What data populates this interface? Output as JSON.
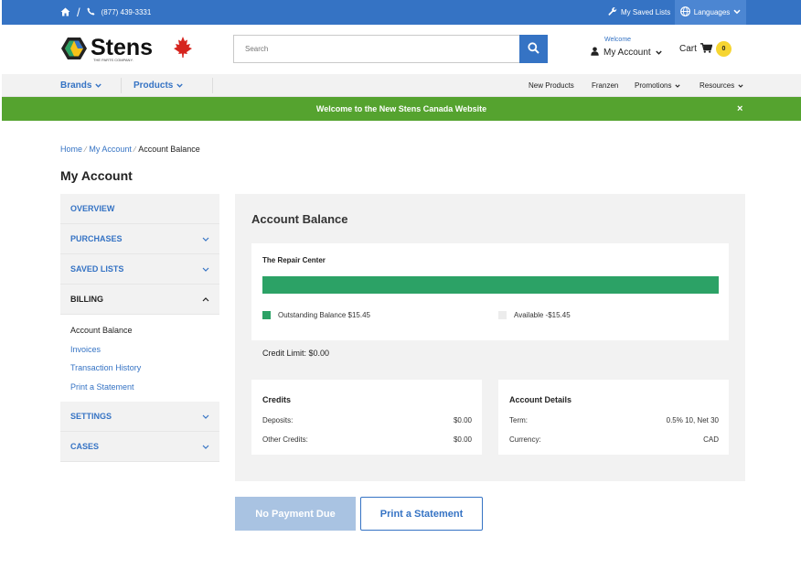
{
  "topbar": {
    "phone": "(877) 439-3331",
    "saved_lists": "My Saved Lists",
    "languages": "Languages"
  },
  "header": {
    "logo_text": "Stens",
    "logo_tagline": "THE PARTS COMPANY.",
    "search_placeholder": "Search",
    "welcome": "Welcome",
    "account": "My Account",
    "cart": "Cart",
    "cart_count": "0"
  },
  "nav": {
    "brands": "Brands",
    "products": "Products",
    "new_products": "New Products",
    "franzen": "Franzen",
    "promotions": "Promotions",
    "resources": "Resources"
  },
  "banner": {
    "message": "Welcome to the New Stens Canada Website",
    "close": "×"
  },
  "breadcrumb": {
    "home": "Home",
    "my_account": "My Account",
    "current": "Account Balance",
    "divider": "⁄"
  },
  "page_title": "My Account",
  "sidebar": {
    "overview": "OVERVIEW",
    "purchases": "PURCHASES",
    "saved_lists": "SAVED LISTS",
    "billing": "BILLING",
    "billing_items": [
      "Account Balance",
      "Invoices",
      "Transaction History",
      "Print a Statement"
    ],
    "settings": "SETTINGS",
    "cases": "CASES"
  },
  "balance": {
    "title": "Account Balance",
    "company": "The Repair Center",
    "outstanding_fraction": 1.0,
    "outstanding_label": "Outstanding Balance $15.45",
    "available_label": "Available -$15.45",
    "credit_limit": "Credit Limit: $0.00",
    "colors": {
      "outstanding": "#2ca266",
      "available": "#e8e8e8"
    }
  },
  "credits": {
    "title": "Credits",
    "rows": [
      {
        "label": "Deposits:",
        "value": "$0.00"
      },
      {
        "label": "Other Credits:",
        "value": "$0.00"
      }
    ]
  },
  "account_details": {
    "title": "Account Details",
    "rows": [
      {
        "label": "Term:",
        "value": "0.5% 10, Net 30"
      },
      {
        "label": "Currency:",
        "value": "CAD"
      }
    ]
  },
  "buttons": {
    "no_payment": "No Payment Due",
    "print_statement": "Print a Statement"
  },
  "colors": {
    "brand_blue": "#3573c4",
    "banner_green": "#55a32f",
    "cart_badge": "#f6d531"
  }
}
